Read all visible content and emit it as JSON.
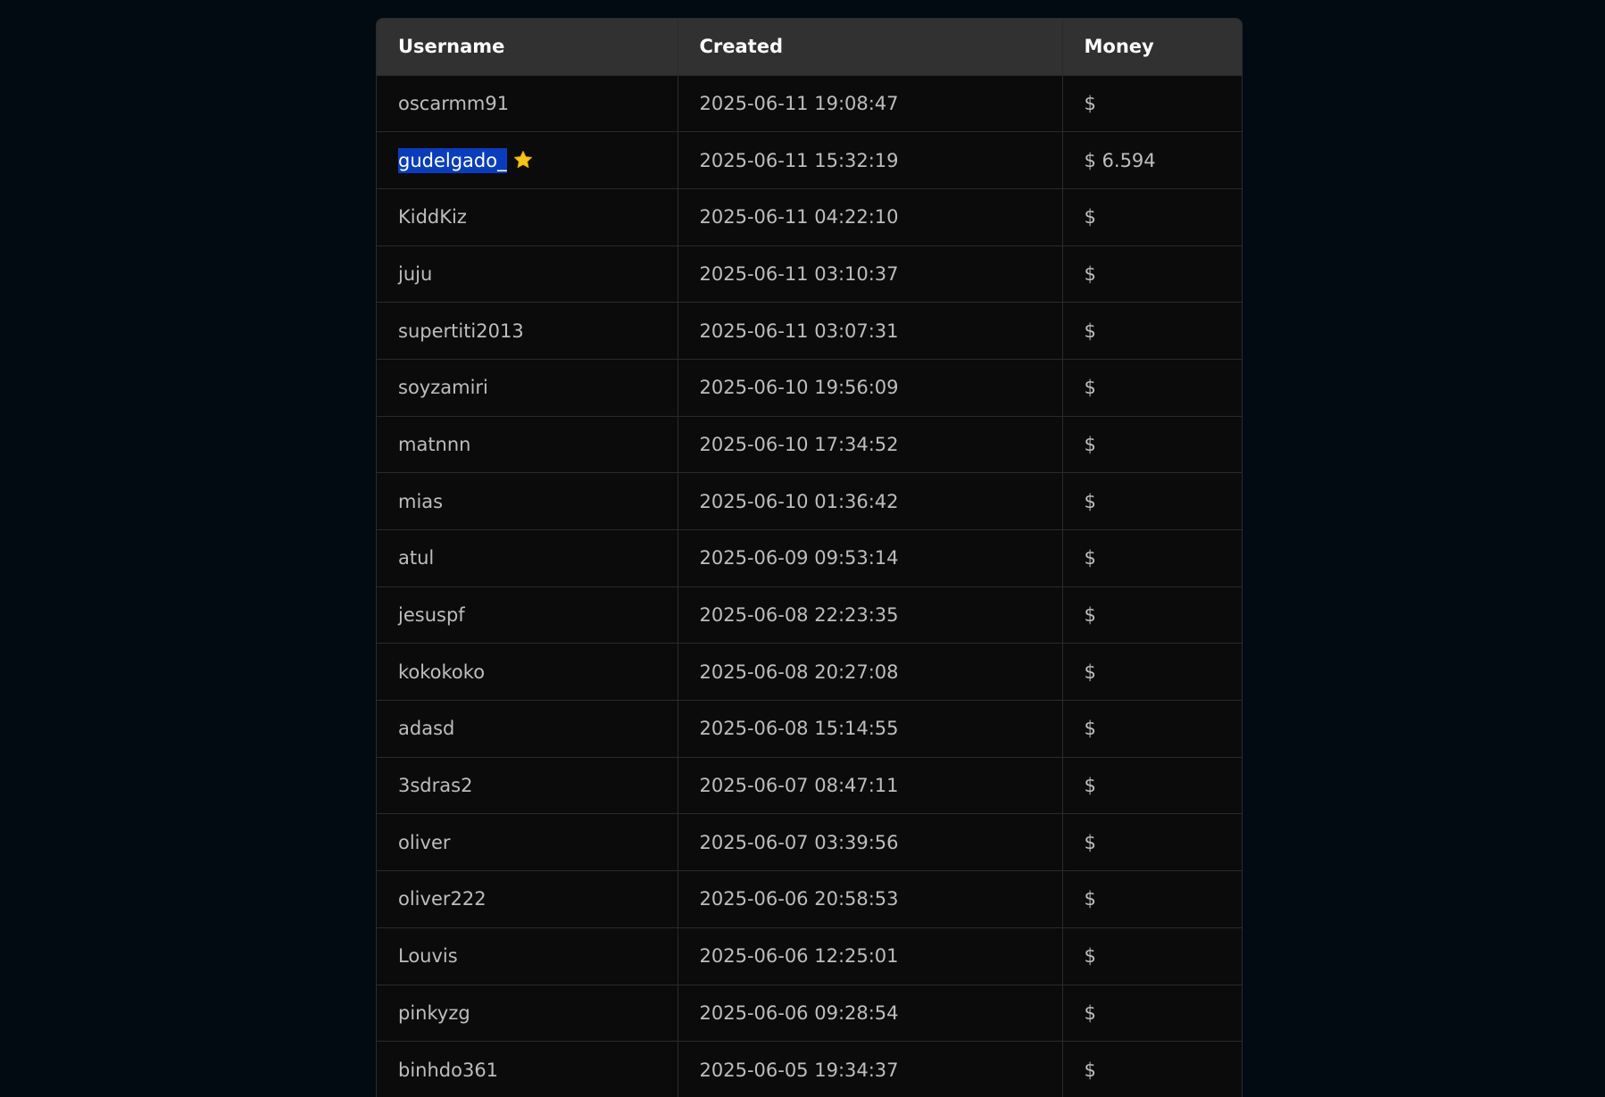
{
  "table": {
    "headers": {
      "username": "Username",
      "created": "Created",
      "money": "Money"
    },
    "rows": [
      {
        "username": "oscarmm91",
        "created": "2025-06-11 19:08:47",
        "money": "$"
      },
      {
        "username": "gudelgado_",
        "created": "2025-06-11 15:32:19",
        "money": "$ 6.594",
        "selected": true,
        "starred": true
      },
      {
        "username": "KiddKiz",
        "created": "2025-06-11 04:22:10",
        "money": "$"
      },
      {
        "username": "juju",
        "created": "2025-06-11 03:10:37",
        "money": "$"
      },
      {
        "username": "supertiti2013",
        "created": "2025-06-11 03:07:31",
        "money": "$"
      },
      {
        "username": "soyzamiri",
        "created": "2025-06-10 19:56:09",
        "money": "$"
      },
      {
        "username": "matnnn",
        "created": "2025-06-10 17:34:52",
        "money": "$"
      },
      {
        "username": "mias",
        "created": "2025-06-10 01:36:42",
        "money": "$"
      },
      {
        "username": "atul",
        "created": "2025-06-09 09:53:14",
        "money": "$"
      },
      {
        "username": "jesuspf",
        "created": "2025-06-08 22:23:35",
        "money": "$"
      },
      {
        "username": "kokokoko",
        "created": "2025-06-08 20:27:08",
        "money": "$"
      },
      {
        "username": "adasd",
        "created": "2025-06-08 15:14:55",
        "money": "$"
      },
      {
        "username": "3sdras2",
        "created": "2025-06-07 08:47:11",
        "money": "$"
      },
      {
        "username": "oliver",
        "created": "2025-06-07 03:39:56",
        "money": "$"
      },
      {
        "username": "oliver222",
        "created": "2025-06-06 20:58:53",
        "money": "$"
      },
      {
        "username": "Louvis",
        "created": "2025-06-06 12:25:01",
        "money": "$"
      },
      {
        "username": "pinkyzg",
        "created": "2025-06-06 09:28:54",
        "money": "$"
      },
      {
        "username": "binhdo361",
        "created": "2025-06-05 19:34:37",
        "money": "$"
      }
    ]
  },
  "icons": {
    "star": "star-icon"
  },
  "colors": {
    "background": "#020a12",
    "header_bg": "#313131",
    "row_bg": "#0b0b0c",
    "selection": "#0a3dbd",
    "star": "#f5c518"
  }
}
